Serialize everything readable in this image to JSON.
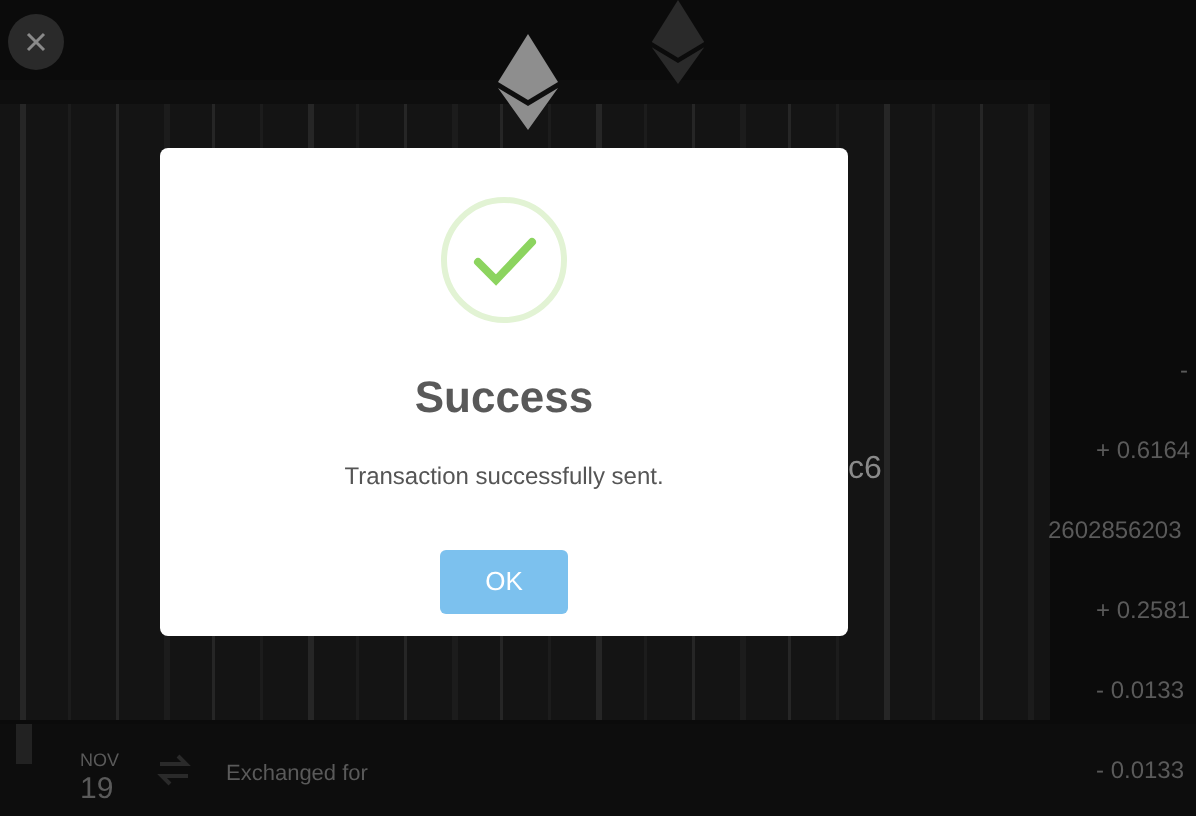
{
  "background": {
    "address_tail": "c6",
    "amounts": [
      "-",
      "+ 0.6164",
      "2602856203",
      "+ 0.2581",
      "- 0.0133",
      "- 0.0133"
    ],
    "transaction": {
      "month": "NOV",
      "day": "19",
      "label": "Exchanged for"
    }
  },
  "dialog": {
    "kind": "success",
    "title": "Success",
    "message": "Transaction successfully sent.",
    "button": "OK"
  }
}
